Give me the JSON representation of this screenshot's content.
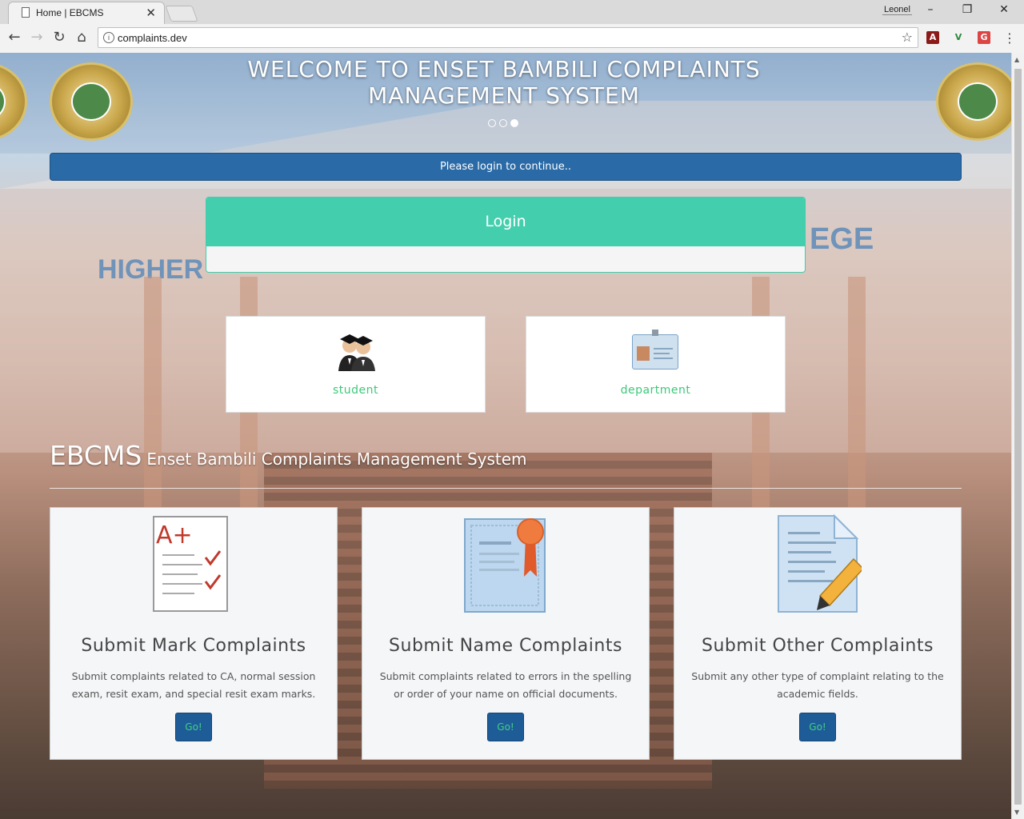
{
  "browser": {
    "tab_title": "Home | EBCMS",
    "user_chip": "Leonel",
    "url": "complaints.dev",
    "window_controls": [
      "–",
      "❐",
      "✕"
    ]
  },
  "hero": {
    "title": "WELCOME TO ENSET BAMBILI COMPLAINTS MANAGEMENT SYSTEM",
    "slides": 3,
    "active_slide": 3
  },
  "notice": "Please login to continue..",
  "login": {
    "heading": "Login"
  },
  "roles": [
    {
      "label": "student",
      "icon": "students-icon"
    },
    {
      "label": "department",
      "icon": "id-badge-icon"
    }
  ],
  "brand": {
    "short": "EBCMS",
    "long": "Enset Bambili Complaints Management System"
  },
  "background_text": {
    "higher": "HIGHER",
    "ege": "EGE"
  },
  "features": [
    {
      "title": "Submit Mark Complaints",
      "description": "Submit complaints related to CA, normal session exam, resit exam, and special resit exam marks.",
      "button": "Go!",
      "icon": "graded-paper-icon"
    },
    {
      "title": "Submit Name Complaints",
      "description": "Submit complaints related to errors in the spelling or order of your name on official documents.",
      "button": "Go!",
      "icon": "certificate-icon"
    },
    {
      "title": "Submit Other Complaints",
      "description": "Submit any other type of complaint relating to the academic fields.",
      "button": "Go!",
      "icon": "document-pencil-icon"
    }
  ],
  "colors": {
    "login_bar": "#2a6aa7",
    "login_header": "#43cfad",
    "role_label": "#3ec97a",
    "go_button": "#1e5c98"
  }
}
